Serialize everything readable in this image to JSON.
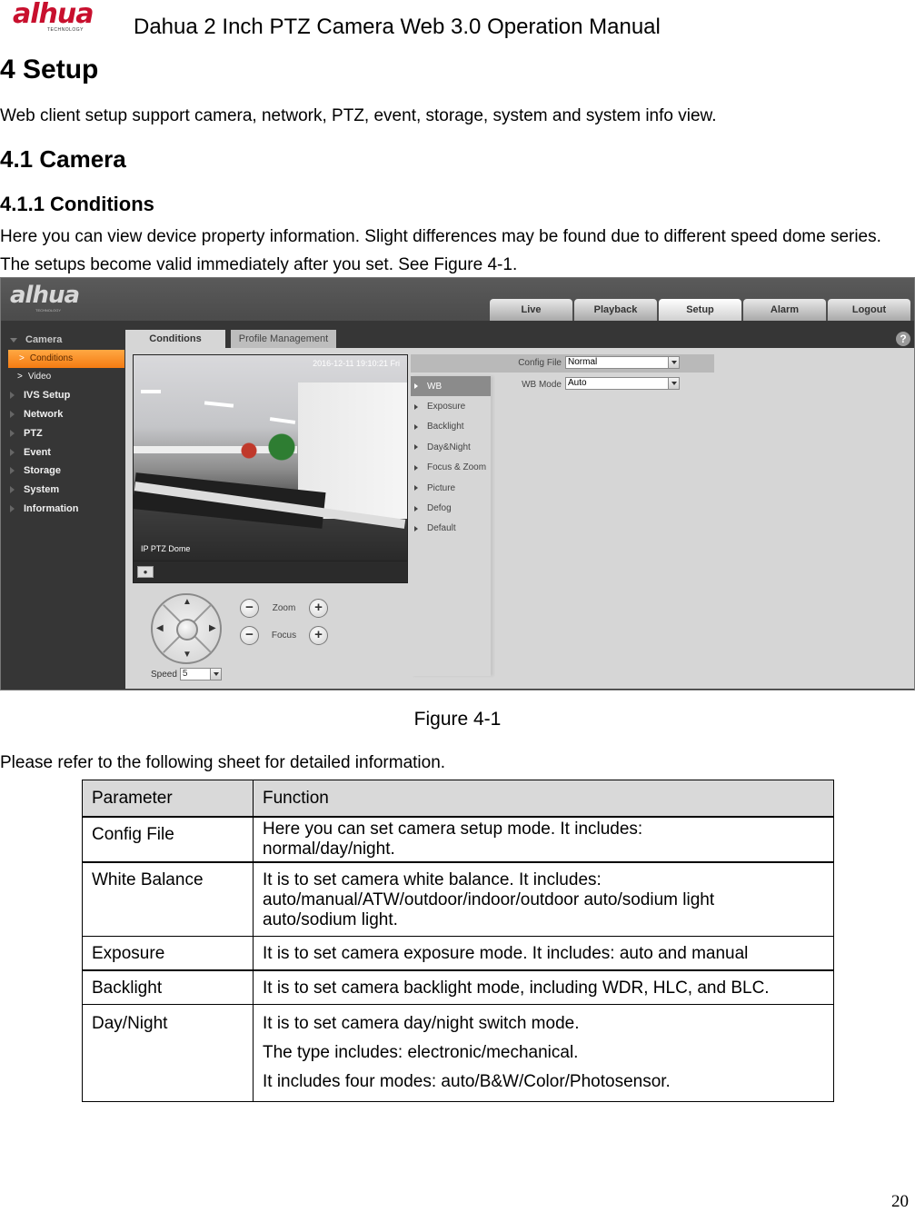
{
  "header": {
    "logo_text": "alhua",
    "logo_sub": "TECHNOLOGY",
    "title": "Dahua 2 Inch PTZ Camera Web 3.0 Operation Manual"
  },
  "section": {
    "heading": "4  Setup",
    "intro": "Web client setup support camera, network, PTZ, event, storage, system and system info view.",
    "sub_heading": "4.1   Camera",
    "subsub_heading": "4.1.1   Conditions",
    "description": "Here you can view device property information. Slight differences may be found due to different speed dome series. The setups become valid immediately after you set. See Figure 4-1."
  },
  "figure": {
    "caption": "Figure 4-1",
    "ui": {
      "logo_text": "alhua",
      "logo_sub": "TECHNOLOGY",
      "nav_tabs": [
        {
          "label": "Live",
          "active": false
        },
        {
          "label": "Playback",
          "active": false
        },
        {
          "label": "Setup",
          "active": true
        },
        {
          "label": "Alarm",
          "active": false
        },
        {
          "label": "Logout",
          "active": false
        }
      ],
      "sidebar": {
        "camera": "Camera",
        "sub_items": [
          {
            "label": "Conditions",
            "active": true
          },
          {
            "label": "Video",
            "active": false
          }
        ],
        "items": [
          "IVS Setup",
          "Network",
          "PTZ",
          "Event",
          "Storage",
          "System",
          "Information"
        ]
      },
      "tabs": [
        {
          "label": "Conditions",
          "active": true
        },
        {
          "label": "Profile Management",
          "active": false
        }
      ],
      "help_icon": "?",
      "video": {
        "timestamp": "2016-12-11 19:10:21 Fri",
        "camera_name": "IP PTZ Dome",
        "snapshot_icon": "camera-icon"
      },
      "ptz": {
        "zoom_label": "Zoom",
        "focus_label": "Focus",
        "minus": "−",
        "plus": "+",
        "speed_label": "Speed",
        "speed_value": "5"
      },
      "config_file": {
        "label": "Config File",
        "value": "Normal"
      },
      "wb_mode": {
        "label": "WB Mode",
        "value": "Auto"
      },
      "menu": [
        {
          "label": "WB",
          "active": true
        },
        {
          "label": "Exposure",
          "active": false
        },
        {
          "label": "Backlight",
          "active": false
        },
        {
          "label": "Day&Night",
          "active": false
        },
        {
          "label": "Focus & Zoom",
          "active": false
        },
        {
          "label": "Picture",
          "active": false
        },
        {
          "label": "Defog",
          "active": false
        },
        {
          "label": "Default",
          "active": false
        }
      ],
      "colors": {
        "accent_orange": "#f58a1f",
        "dark_bg": "#363636",
        "panel_bg": "#d6d6d6"
      }
    }
  },
  "table_intro": "Please refer to the following sheet for detailed information.",
  "table": {
    "headers": [
      "Parameter",
      "Function"
    ],
    "rows": [
      {
        "param": "Config File",
        "lines": [
          "Here you can set camera setup mode. It includes:",
          "normal/day/night."
        ]
      },
      {
        "param": "White Balance",
        "lines": [
          "It is to set camera white balance. It includes:",
          "auto/manual/ATW/outdoor/indoor/outdoor auto/sodium light",
          "auto/sodium light."
        ]
      },
      {
        "param": "Exposure",
        "lines": [
          "It is to set camera exposure mode. It includes: auto and manual"
        ]
      },
      {
        "param": "Backlight",
        "lines": [
          "It is to set camera backlight mode, including WDR, HLC, and BLC."
        ]
      },
      {
        "param": "Day/Night",
        "lines": [
          "It is to set camera day/night switch mode.",
          "The type includes: electronic/mechanical.",
          "It includes four modes: auto/B&W/Color/Photosensor."
        ]
      }
    ]
  },
  "page_number": "20"
}
